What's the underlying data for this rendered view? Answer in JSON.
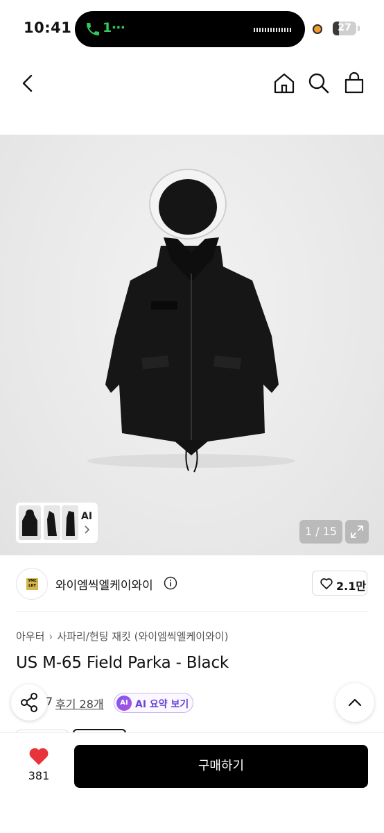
{
  "status_bar": {
    "time": "10:41",
    "call_label": "1⋯",
    "battery_level": 27,
    "battery_label": "27"
  },
  "nav": {
    "back_icon": "chevron-left-icon",
    "home_icon": "home-icon",
    "search_icon": "search-icon",
    "cart_icon": "shopping-bag-icon"
  },
  "gallery": {
    "thumbs_ai_label": "AI",
    "counter": "1 / 15",
    "expand_icon": "expand-icon"
  },
  "shop": {
    "name": "와이엠씩엘케이와이",
    "logo_text": "YMC LKY",
    "like_count": "2.1만"
  },
  "breadcrumb": {
    "items": [
      "아우터",
      "사파리/헌팅 재킷 (와이엠씩엘케이와이)"
    ]
  },
  "product": {
    "title": "US M-65 Field Parka - Black",
    "rating_tail": "7",
    "reviews": "후기 28개",
    "ai_badge": "AI",
    "ai_summary": "AI 요약 보기"
  },
  "bottom_bar": {
    "wish_count": "381",
    "buy_label": "구매하기"
  },
  "colors": {
    "accent": "#000000",
    "heart": "#e8323c",
    "ai_purple": "#6a43d8",
    "call_green": "#34c759"
  }
}
